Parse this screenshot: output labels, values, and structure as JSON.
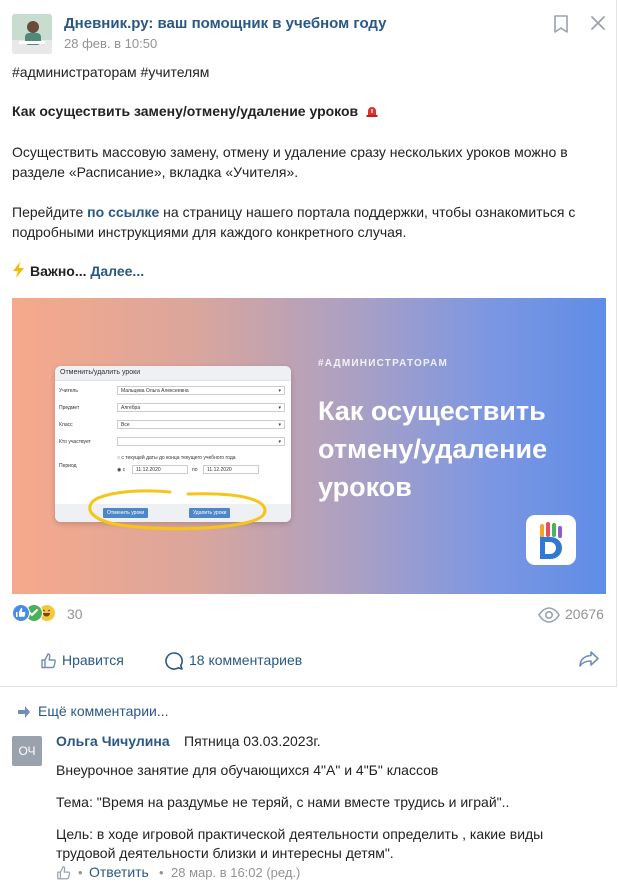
{
  "post": {
    "author": "Дневник.ру: ваш помощник в учебном году",
    "date": "28 фев. в 10:50",
    "hashtags": "#администраторам #учителям",
    "heading": "Как осуществить замену/отмену/удаление уроков",
    "paragraph1": "Осуществить массовую замену, отмену и удаление сразу нескольких уроков можно в разделе «Расписание», вкладка «Учителя».",
    "p2_before": "Перейдите ",
    "p2_link": "по ссылке",
    "p2_after": " на страницу нашего портала поддержки, чтобы ознакомиться с подробными инструкциями для каждого конкретного случая.",
    "important": "Важно...",
    "more_link": "Далее..."
  },
  "banner": {
    "tag": "#АДМИНИСТРАТОРАМ",
    "title": "Как осуществить отмену/удаление уроков",
    "mock": {
      "header": "Отменить/удалить уроки",
      "rows": [
        {
          "label": "Учитель",
          "value": "Мальцева Ольга Алексеевна"
        },
        {
          "label": "Предмет",
          "value": "Алгебра"
        },
        {
          "label": "Класс",
          "value": "Все"
        },
        {
          "label": "Кто участвует",
          "value": ""
        }
      ],
      "period_label": "Период",
      "period_option1": "с текущей даты до конца текущего учебного года",
      "period_from_prefix": "с",
      "period_from": "11.12.2020",
      "period_to_prefix": "по",
      "period_to": "11.12.2020",
      "btn_cancel": "Отменить уроки",
      "btn_delete": "Удалить уроки"
    }
  },
  "stats": {
    "reactions_count": "30",
    "views": "20676"
  },
  "actions": {
    "like": "Нравится",
    "comments": "18 комментариев"
  },
  "comments": {
    "more": "Ещё комментарии...",
    "item": {
      "avatar_initials": "ОЧ",
      "name": "Ольга Чичулина",
      "date_text": "Пятница 03.03.2023г.",
      "line1": "Внеурочное занятие для обучающихся 4\"А\" и 4\"Б\" классов",
      "line2": "Тема: \"Время на раздумье не теряй, с нами вместе трудись и играй\"..",
      "line3": "Цель: в ходе игровой практической деятельности определить , какие виды трудовой деятельности близки и интересны детям\".",
      "reply": "Ответить",
      "sep": "•",
      "time": "28 мар. в 16:02 (ред.)"
    }
  },
  "colors": {
    "link": "#2a5885",
    "muted": "#939393",
    "banner_start": "#f7a98b",
    "banner_end": "#5f8de6"
  }
}
